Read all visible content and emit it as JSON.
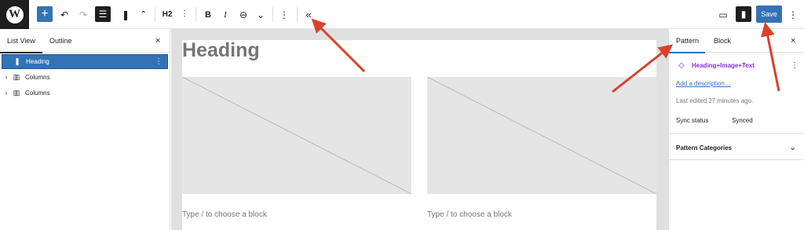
{
  "toolbar": {
    "logo_label": "W",
    "add_icon": "+",
    "undo_icon": "↶",
    "redo_icon": "↷",
    "document_overview_icon": "☰",
    "bookmark_icon": "❚",
    "move_icon": "⌃",
    "heading_level": "H2",
    "align_icon": "⫶",
    "bold_label": "B",
    "italic_label": "I",
    "link_icon": "⊖",
    "more_rich_icon": "⌄",
    "options_icon": "⋮",
    "collapse_icon": "«",
    "preview_icon": "▭",
    "settings_icon": "▮",
    "save_label": "Save",
    "kebab_icon": "⋮"
  },
  "left_panel": {
    "tabs": [
      {
        "label": "List View"
      },
      {
        "label": "Outline"
      }
    ],
    "close_icon": "×",
    "items": [
      {
        "label": "Heading",
        "icon": "bookmark-icon",
        "icon_glyph": "❚",
        "selected": true,
        "options": "⋮"
      },
      {
        "label": "Columns",
        "icon": "columns-icon",
        "icon_glyph": "▥",
        "chevron": "›"
      },
      {
        "label": "Columns",
        "icon": "columns-icon",
        "icon_glyph": "▥",
        "chevron": "›"
      }
    ]
  },
  "canvas": {
    "heading": "Heading",
    "placeholder_text_left": "Type / to choose a block",
    "placeholder_text_right": "Type / to choose a block"
  },
  "right_panel": {
    "tabs": [
      {
        "label": "Pattern"
      },
      {
        "label": "Block"
      }
    ],
    "close_icon": "×",
    "pattern_icon": "◇",
    "pattern_name": "Heading+Image+Text",
    "pattern_options": "⋮",
    "add_description": "Add a description…",
    "last_edited": "Last edited 27 minutes ago.",
    "sync_status_label": "Sync status",
    "sync_status_value": "Synced",
    "categories_label": "Pattern Categories",
    "categories_chevron": "⌄"
  },
  "colors": {
    "accent": "#3373b5",
    "annotation_arrow": "#d9412a",
    "pattern_purple": "#8a2be2"
  }
}
